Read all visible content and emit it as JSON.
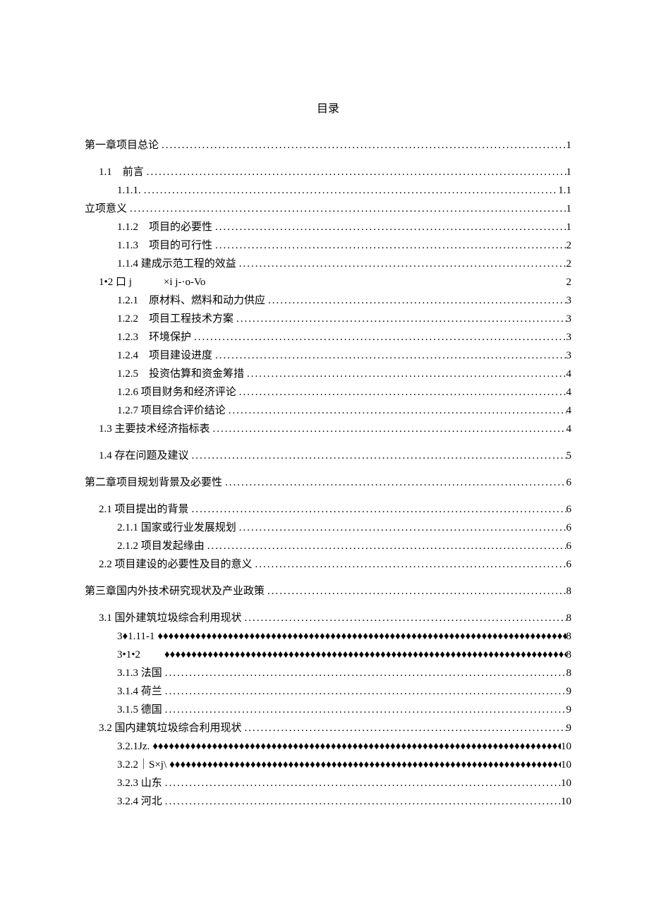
{
  "title": "目录",
  "entries": [
    {
      "level": 0,
      "label": "第一章项目总论",
      "page": "1",
      "leader": "dot"
    },
    {
      "level": 1,
      "label": "1.1　前言",
      "page": "1",
      "leader": "dot",
      "spacedTop": true
    },
    {
      "level": 2,
      "label": "1.1.1.",
      "page": "1.1",
      "leader": "dot"
    },
    {
      "level": 0,
      "label": "立项意义",
      "page": "1",
      "leader": "dot",
      "noTopMargin": true
    },
    {
      "level": 2,
      "label": "1.1.2　项目的必要性",
      "page": "1",
      "leader": "dot"
    },
    {
      "level": 2,
      "label": "1.1.3　项目的可行性",
      "page": "2",
      "leader": "dot"
    },
    {
      "level": 2,
      "label": "1.1.4 建成示范工程的效益",
      "page": "2",
      "leader": "dot"
    },
    {
      "level": 1,
      "label": "1•2 口 j　　　×i j-·o-Vo",
      "page": "2",
      "leader": "space"
    },
    {
      "level": 2,
      "label": "1.2.1　原材料、燃料和动力供应",
      "page": "3",
      "leader": "dot"
    },
    {
      "level": 2,
      "label": "1.2.2　项目工程技术方案",
      "page": "3",
      "leader": "dot"
    },
    {
      "level": 2,
      "label": "1.2.3　环境保护",
      "page": "3",
      "leader": "dot"
    },
    {
      "level": 2,
      "label": "1.2.4　项目建设进度",
      "page": "3",
      "leader": "dot"
    },
    {
      "level": 2,
      "label": "1.2.5　投资估算和资金筹措",
      "page": "4",
      "leader": "dot"
    },
    {
      "level": 2,
      "label": "1.2.6 项目财务和经济评论",
      "page": "4",
      "leader": "dot"
    },
    {
      "level": 2,
      "label": "1.2.7 项目综合评价结论",
      "page": "4",
      "leader": "dot"
    },
    {
      "level": 1,
      "label": "1.3 主要技术经济指标表",
      "page": "4",
      "leader": "dot"
    },
    {
      "level": 1,
      "label": "1.4 存在问题及建议",
      "page": "5",
      "leader": "dot",
      "spacedTop": true
    },
    {
      "level": 0,
      "label": "第二章项目规划背景及必要性",
      "page": "6",
      "leader": "dot"
    },
    {
      "level": 1,
      "label": "2.1 项目提出的背景",
      "page": "6",
      "leader": "dot",
      "spacedTop": true
    },
    {
      "level": 2,
      "label": "2.1.1 国家或行业发展规划",
      "page": "6",
      "leader": "dot"
    },
    {
      "level": 2,
      "label": "2.1.2 项目发起缘由",
      "page": "6",
      "leader": "dot"
    },
    {
      "level": 1,
      "label": "2.2 项目建设的必要性及目的意义",
      "page": "6",
      "leader": "dot"
    },
    {
      "level": 0,
      "label": "第三章国内外技术研究现状及产业政策",
      "page": "8",
      "leader": "dot"
    },
    {
      "level": 1,
      "label": "3.1 国外建筑垃圾综合利用现状",
      "page": "8",
      "leader": "dot",
      "spacedTop": true
    },
    {
      "level": 2,
      "label": "3♦1.11-1",
      "page": "8",
      "leader": "diamond"
    },
    {
      "level": 2,
      "label": "3•1•2　　",
      "page": "8",
      "leader": "diamond"
    },
    {
      "level": 2,
      "label": "3.1.3 法国",
      "page": "8",
      "leader": "dot"
    },
    {
      "level": 2,
      "label": "3.1.4 荷兰",
      "page": "9",
      "leader": "dot"
    },
    {
      "level": 2,
      "label": "3.1.5 德国",
      "page": "9",
      "leader": "dot"
    },
    {
      "level": 1,
      "label": "3.2 国内建筑垃圾综合利用现状",
      "page": "9",
      "leader": "dot"
    },
    {
      "level": 2,
      "label": "3.2.1Jz.",
      "page": "10",
      "leader": "diamond"
    },
    {
      "level": 2,
      "label": "3.2.2｜S×j\\",
      "page": "10",
      "leader": "diamond"
    },
    {
      "level": 2,
      "label": "3.2.3 山东",
      "page": "10",
      "leader": "dot"
    },
    {
      "level": 2,
      "label": "3.2.4 河北",
      "page": "10",
      "leader": "dot"
    }
  ]
}
